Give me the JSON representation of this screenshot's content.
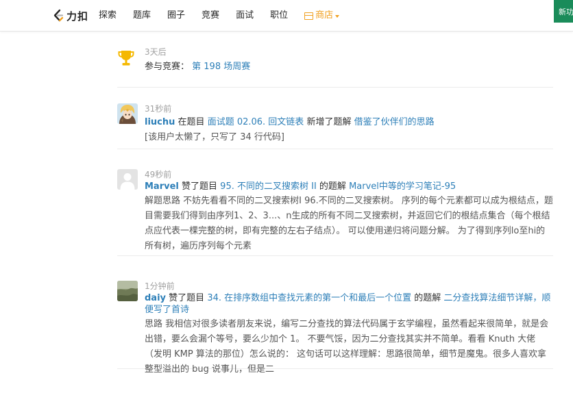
{
  "header": {
    "logo_text": "力扣",
    "nav": [
      "探索",
      "题库",
      "圈子",
      "竞赛",
      "面试",
      "职位"
    ],
    "shop_label": "商店",
    "new_button_label": "新功"
  },
  "feed": [
    {
      "time": "3天后",
      "text1": "参与竞赛：",
      "link1": "第 198 场周赛"
    },
    {
      "time": "31秒前",
      "user": "liuchu",
      "text1": "在题目",
      "link1": "面试题 02.06. 回文链表",
      "text2": "新增了题解",
      "link2": "借鉴了伙伴们的思路",
      "desc": "[该用户太懒了，只写了 34 行代码]"
    },
    {
      "time": "49秒前",
      "user": "Marvel",
      "text1": "赞了题目",
      "link1": "95. 不同的二叉搜索树 II",
      "text2": "的题解",
      "link2": "Marvel中等的学习笔记-95",
      "desc": "解题思路 不妨先看看不同的二叉搜索树I 96.不同的二叉搜索树。 序列的每个元素都可以成为根结点，题目需要我们得到由序列1、2、3...、n生成的所有不同二叉搜索树，并返回它们的根结点集合（每个根结点应代表一棵完整的树，即有完整的左右子结点）。 可以使用递归将问题分解。 为了得到序列lo至hi的所有树，遍历序列每个元素"
    },
    {
      "time": "1分钟前",
      "user": "daiy",
      "text1": "赞了题目",
      "link1": "34. 在排序数组中查找元素的第一个和最后一个位置",
      "text2": "的题解",
      "link2": "二分查找算法细节详解，顺便写了首诗",
      "desc": "思路 我相信对很多读者朋友来说，编写二分查找的算法代码属于玄学编程，虽然看起来很简单，就是会出错，要么会漏个等号，要么少加个 1。 不要气馁，因为二分查找其实并不简单。看看 Knuth 大佬（发明 KMP 算法的那位）怎么说的： 这句话可以这样理解：思路很简单，细节是魔鬼。很多人喜欢拿整型溢出的 bug 说事儿，但是二"
    }
  ],
  "colors": {
    "link": "#2d7fb8",
    "shop": "#f0a020",
    "trophy": "#f5b800",
    "new_button": "#1a8c5a"
  },
  "icons": [
    "leetcode-logo-icon",
    "shop-icon",
    "chevron-down-icon",
    "trophy-icon",
    "avatar-anime",
    "avatar-default",
    "avatar-landscape"
  ]
}
